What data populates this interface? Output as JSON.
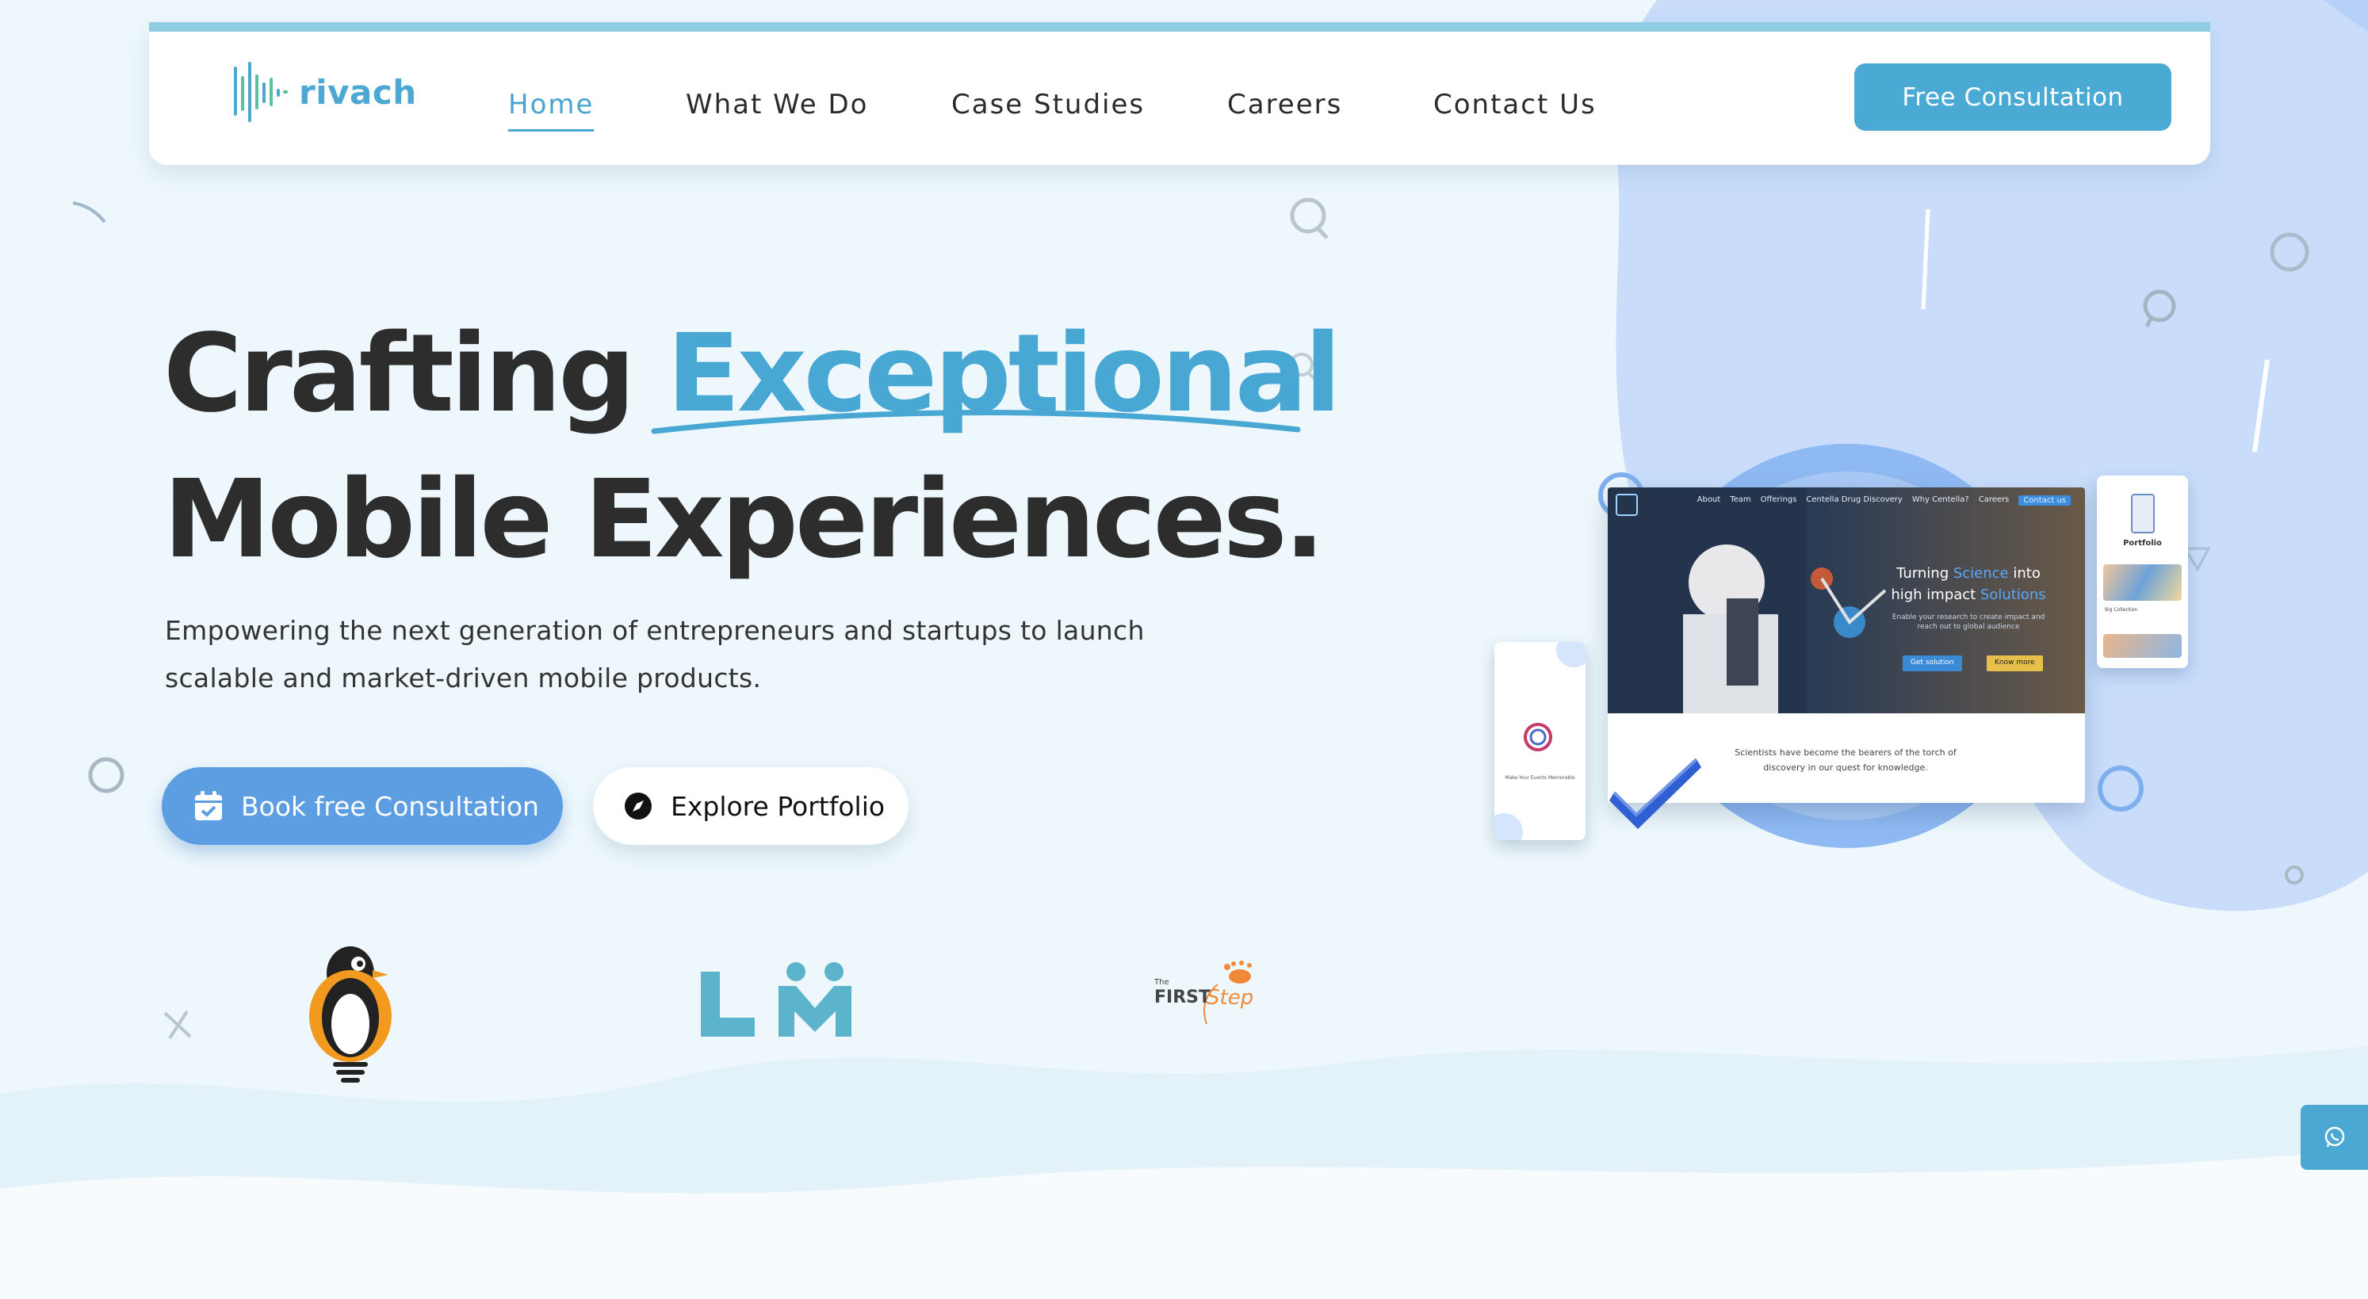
{
  "brand": {
    "name": "rivach"
  },
  "nav": {
    "items": [
      {
        "label": "Home",
        "active": true
      },
      {
        "label": "What We Do",
        "active": false
      },
      {
        "label": "Case Studies",
        "active": false
      },
      {
        "label": "Careers",
        "active": false
      },
      {
        "label": "Contact Us",
        "active": false
      }
    ],
    "cta_label": "Free Consultation"
  },
  "hero": {
    "title_part1": "Crafting ",
    "title_highlight": "Exceptional",
    "title_part2": "Mobile Experiences.",
    "subtitle_line1": "Empowering the next generation of entrepreneurs and startups to launch",
    "subtitle_line2": "scalable and market-driven mobile products.",
    "primary_button": "Book free Consultation",
    "secondary_button": "Explore Portfolio"
  },
  "mockup": {
    "laptop_nav": [
      "About",
      "Team",
      "Offerings",
      "Centella Drug Discovery",
      "Why Centella?",
      "Careers",
      "Contact us"
    ],
    "headline_pre": "Turning ",
    "headline_colored": "Science",
    "headline_mid": " into",
    "headline_line2_pre": "high impact ",
    "headline_line2_colored": "Solutions",
    "description": "Enable your research to create impact and reach out to global audience",
    "btn_solution": "Get solution",
    "btn_know": "Know more",
    "quote": "Scientists have become the bearers of the torch of discovery in our quest for knowledge.",
    "phone_left_text": "Make Your Events Memorable",
    "phone_right_title": "Portfolio",
    "phone_right_sub": "Big Collection"
  },
  "client_logos": {
    "firststep_small": "The",
    "firststep_first": "FIRST",
    "firststep_step": "Step"
  },
  "colors": {
    "accent": "#48a8d3",
    "primary_button": "#5d9ee3",
    "background": "#eef8fc",
    "blob": "#c7dcfb"
  },
  "icons": {
    "calendar": "calendar-check-icon",
    "compass": "compass-icon",
    "whatsapp": "whatsapp-icon"
  }
}
